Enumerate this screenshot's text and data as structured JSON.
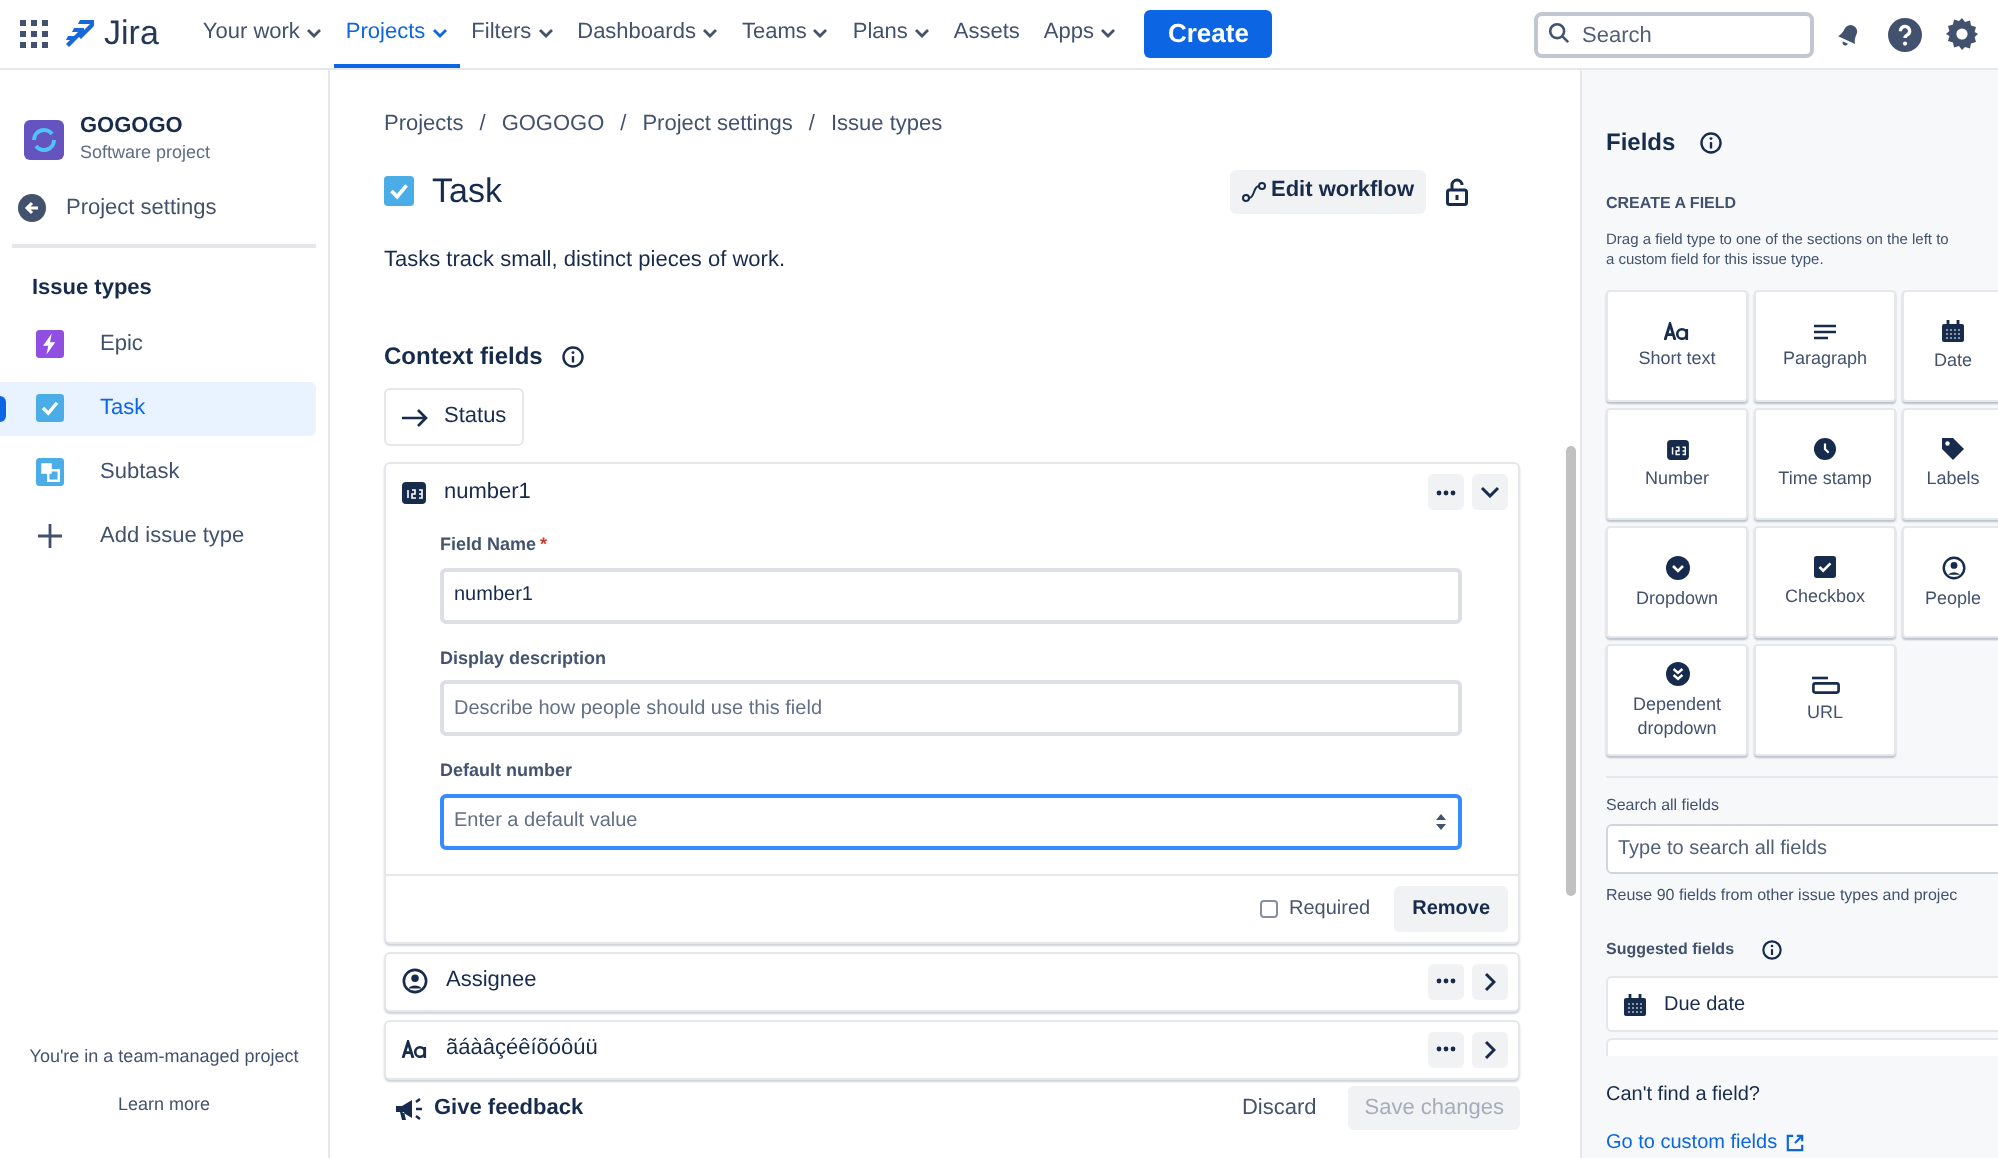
{
  "nav": {
    "brand": "Jira",
    "items": [
      {
        "label": "Your work",
        "menu": true,
        "selected": false
      },
      {
        "label": "Projects",
        "menu": true,
        "selected": true
      },
      {
        "label": "Filters",
        "menu": true,
        "selected": false
      },
      {
        "label": "Dashboards",
        "menu": true,
        "selected": false
      },
      {
        "label": "Teams",
        "menu": true,
        "selected": false
      },
      {
        "label": "Plans",
        "menu": true,
        "selected": false
      },
      {
        "label": "Assets",
        "menu": false,
        "selected": false
      },
      {
        "label": "Apps",
        "menu": true,
        "selected": false
      }
    ],
    "create": "Create",
    "search": {
      "placeholder": "Search"
    }
  },
  "sidebar": {
    "project": {
      "name": "GOGOGO",
      "type": "Software project"
    },
    "back": "Project settings",
    "heading": "Issue types",
    "items": [
      {
        "label": "Epic",
        "kind": "epic",
        "selected": false
      },
      {
        "label": "Task",
        "kind": "task",
        "selected": true
      },
      {
        "label": "Subtask",
        "kind": "subtask",
        "selected": false
      },
      {
        "label": "Add issue type",
        "kind": "add",
        "selected": false
      }
    ],
    "footer": "You're in a team-managed project",
    "learn_more": "Learn more"
  },
  "main": {
    "breadcrumbs": [
      "Projects",
      "GOGOGO",
      "Project settings",
      "Issue types"
    ],
    "breadcrumb_separator": "/",
    "required_mark": "*",
    "title": "Task",
    "edit_workflow": "Edit workflow",
    "description": "Tasks track small, distinct pieces of work.",
    "context_heading": "Context fields",
    "status_button": "Status",
    "fields": [
      {
        "name": "number1",
        "kind": "number",
        "expanded": true,
        "form": [
          {
            "label": "Field Name",
            "required": true,
            "value": "number1"
          },
          {
            "label": "Display description",
            "required": false,
            "placeholder": "Describe how people should use this field"
          },
          {
            "label": "Default number",
            "required": false,
            "placeholder": "Enter a default value",
            "focused": true,
            "kind": "number"
          }
        ],
        "required_label": "Required",
        "required_checked": false,
        "remove": "Remove"
      },
      {
        "name": "Assignee",
        "kind": "people",
        "expanded": false
      },
      {
        "name": "ãáàâçéêíõóôúü",
        "kind": "text",
        "expanded": false
      }
    ],
    "feedback": "Give feedback",
    "discard": "Discard",
    "save": {
      "label": "Save changes",
      "disabled": true
    }
  },
  "panel": {
    "title": "Fields",
    "create_heading": "CREATE A FIELD",
    "create_hint_lines": [
      "Drag a field type to one of the sections on the left to",
      "a custom field for this issue type."
    ],
    "types": [
      {
        "label": "Short text",
        "kind": "text"
      },
      {
        "label": "Paragraph",
        "kind": "paragraph"
      },
      {
        "label": "Date",
        "kind": "date"
      },
      {
        "label": "Number",
        "kind": "number"
      },
      {
        "label": "Time stamp",
        "kind": "clock"
      },
      {
        "label": "Labels",
        "kind": "tag"
      },
      {
        "label": "Dropdown",
        "kind": "dropdown"
      },
      {
        "label": "Checkbox",
        "kind": "checkbox"
      },
      {
        "label": "People",
        "kind": "people"
      },
      {
        "label": "Dependent dropdown",
        "kind": "dependent"
      },
      {
        "label": "URL",
        "kind": "url"
      }
    ],
    "search_label": "Search all fields",
    "search_placeholder": "Type to search all fields",
    "reuse_note": "Reuse 90 fields from other issue types and projec",
    "suggested_heading": "Suggested fields",
    "suggested": [
      {
        "label": "Due date",
        "kind": "date"
      }
    ],
    "cant_find": "Can't find a field?",
    "custom_link": "Go to custom fields"
  }
}
